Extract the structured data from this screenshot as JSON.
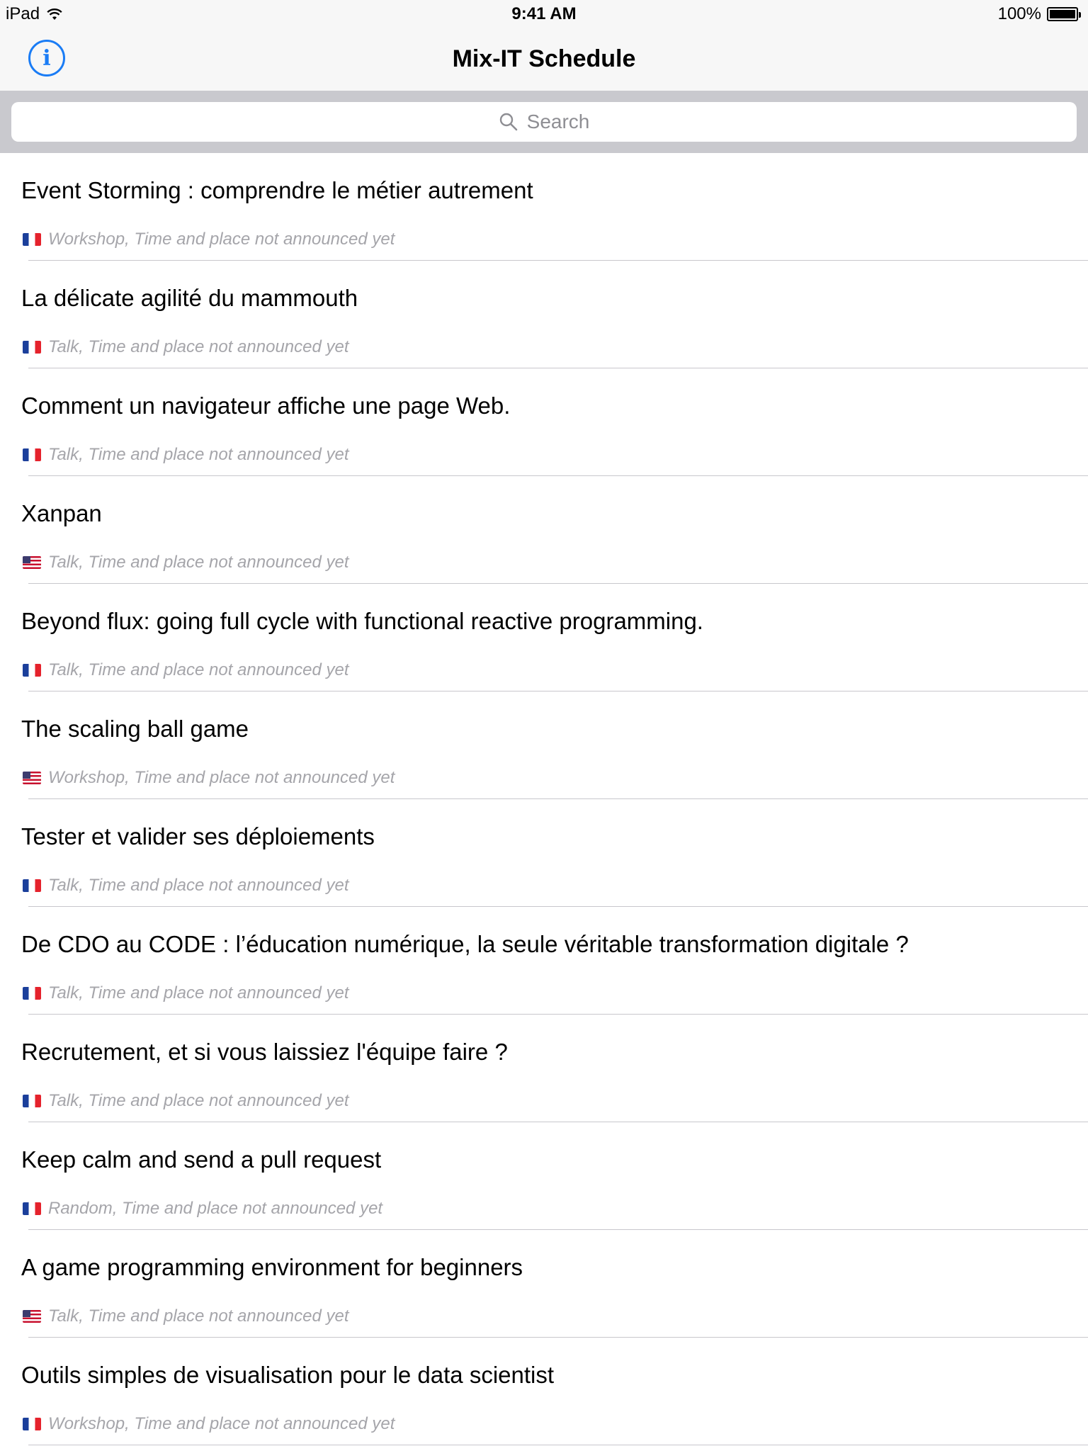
{
  "status_bar": {
    "carrier": "iPad",
    "time": "9:41 AM",
    "battery": "100%"
  },
  "nav": {
    "title": "Mix-IT Schedule",
    "info_icon": "i"
  },
  "search": {
    "placeholder": "Search"
  },
  "sessions": [
    {
      "title": "Event Storming : comprendre le métier autrement",
      "flag": "fr",
      "subtitle": "Workshop, Time and place not announced yet"
    },
    {
      "title": "La délicate agilité du mammouth",
      "flag": "fr",
      "subtitle": "Talk, Time and place not announced yet"
    },
    {
      "title": "Comment un navigateur affiche une page Web.",
      "flag": "fr",
      "subtitle": "Talk, Time and place not announced yet"
    },
    {
      "title": "Xanpan",
      "flag": "us",
      "subtitle": "Talk, Time and place not announced yet"
    },
    {
      "title": "Beyond flux: going full cycle with functional reactive programming.",
      "flag": "fr",
      "subtitle": "Talk, Time and place not announced yet"
    },
    {
      "title": "The scaling ball game",
      "flag": "us",
      "subtitle": "Workshop, Time and place not announced yet"
    },
    {
      "title": "Tester et valider ses déploiements",
      "flag": "fr",
      "subtitle": "Talk, Time and place not announced yet"
    },
    {
      "title": "De CDO au CODE : l’éducation numérique, la seule véritable transformation digitale ?",
      "flag": "fr",
      "subtitle": "Talk, Time and place not announced yet"
    },
    {
      "title": "Recrutement, et si vous laissiez l'équipe faire ?",
      "flag": "fr",
      "subtitle": "Talk, Time and place not announced yet"
    },
    {
      "title": "Keep calm and send a pull request",
      "flag": "fr",
      "subtitle": "Random, Time and place not announced yet"
    },
    {
      "title": "A game programming environment for beginners",
      "flag": "us",
      "subtitle": "Talk, Time and place not announced yet"
    },
    {
      "title": "Outils simples de visualisation pour le data scientist",
      "flag": "fr",
      "subtitle": "Workshop, Time and place not announced yet"
    }
  ],
  "colors": {
    "accent": "#1a7cf5",
    "subtitle": "#a5a5aa",
    "search_bg": "#c9c9ce",
    "bar_bg": "#f7f7f7"
  },
  "icons": {
    "wifi": "wifi-icon",
    "battery": "battery-icon",
    "info": "info-icon",
    "search": "search-icon",
    "flag_fr": "french-flag-icon",
    "flag_us": "us-flag-icon"
  }
}
